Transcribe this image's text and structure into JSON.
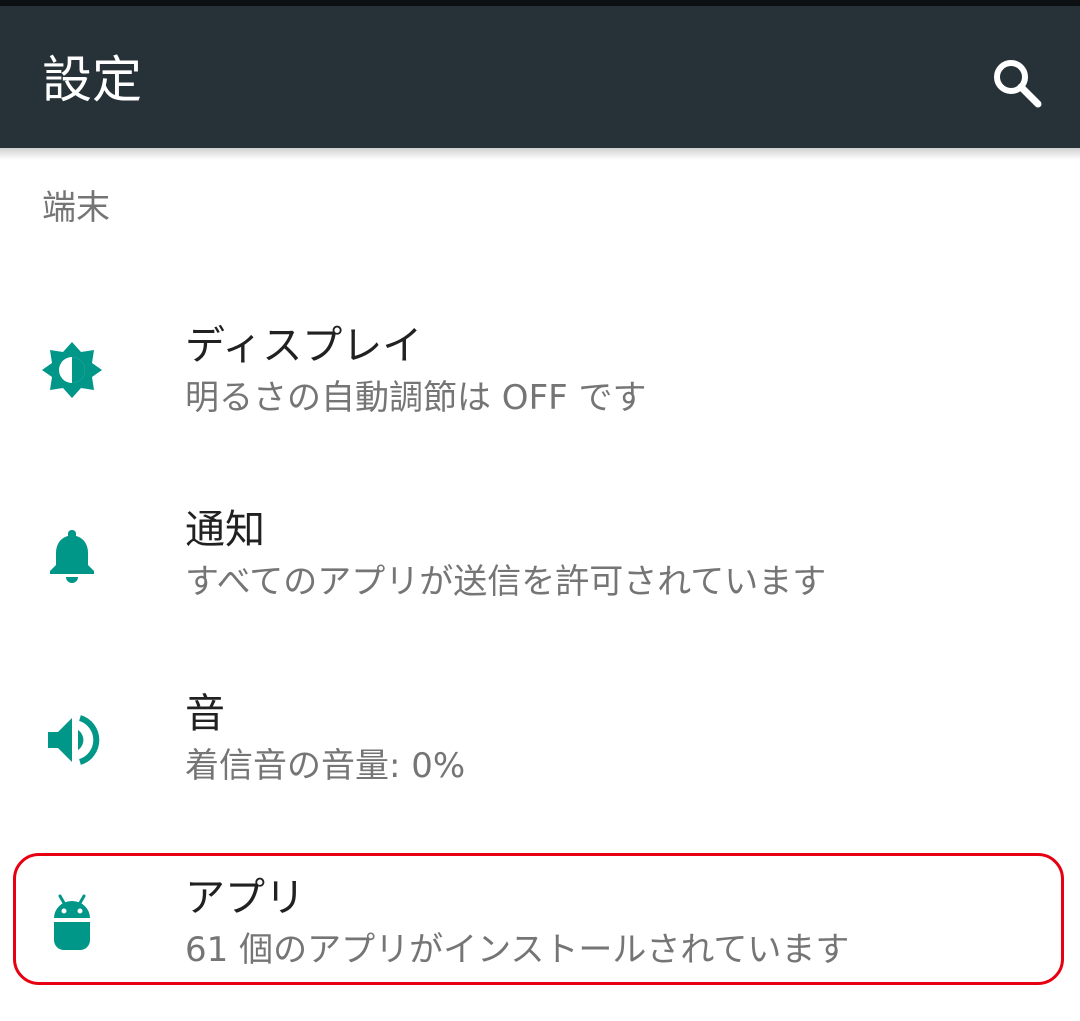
{
  "toolbar": {
    "title": "設定",
    "search_icon": "search-icon",
    "background_color": "#263238"
  },
  "section": {
    "header": "端末"
  },
  "items": [
    {
      "icon": "brightness-icon",
      "title": "ディスプレイ",
      "summary": "明るさの自動調節は OFF です"
    },
    {
      "icon": "bell-icon",
      "title": "通知",
      "summary": "すべてのアプリが送信を許可されています"
    },
    {
      "icon": "volume-icon",
      "title": "音",
      "summary": "着信音の音量: 0%"
    },
    {
      "icon": "android-icon",
      "title": "アプリ",
      "summary": "61 個のアプリがインストールされています"
    }
  ],
  "colors": {
    "accent": "#009688",
    "highlight_border": "#e60012"
  }
}
